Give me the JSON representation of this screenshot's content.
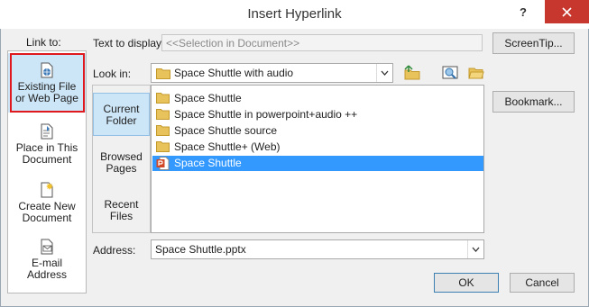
{
  "window": {
    "title": "Insert Hyperlink",
    "help_label": "?",
    "close_icon": "close-icon"
  },
  "link_to": {
    "label": "Link to:",
    "items": [
      {
        "line1": "Existing File",
        "line2": "or Web Page",
        "icon": "globe-document-icon",
        "selected": true
      },
      {
        "line1": "Place in This",
        "line2": "Document",
        "icon": "place-in-document-icon",
        "selected": false
      },
      {
        "line1": "Create New",
        "line2": "Document",
        "icon": "new-document-icon",
        "selected": false
      },
      {
        "line1": "E-mail",
        "line2": "Address",
        "icon": "email-icon",
        "selected": false
      }
    ]
  },
  "text_to_display": {
    "label": "Text to display:",
    "value": "<<Selection in Document>>"
  },
  "buttons": {
    "screentip": "ScreenTip...",
    "bookmark": "Bookmark...",
    "ok": "OK",
    "cancel": "Cancel"
  },
  "look_in": {
    "label": "Look in:",
    "value": "Space Shuttle with audio",
    "tool_icons": [
      "up-one-folder-icon",
      "browse-web-icon",
      "browse-file-icon"
    ]
  },
  "places": [
    {
      "line1": "Current",
      "line2": "Folder",
      "selected": true
    },
    {
      "line1": "Browsed",
      "line2": "Pages",
      "selected": false
    },
    {
      "line1": "Recent",
      "line2": "Files",
      "selected": false
    }
  ],
  "files": [
    {
      "name": "Space Shuttle",
      "type": "folder",
      "selected": false
    },
    {
      "name": "Space Shuttle in powerpoint+audio ++",
      "type": "folder",
      "selected": false
    },
    {
      "name": "Space Shuttle source",
      "type": "folder",
      "selected": false
    },
    {
      "name": "Space Shuttle+ (Web)",
      "type": "folder",
      "selected": false
    },
    {
      "name": "Space Shuttle",
      "type": "powerpoint",
      "selected": true
    }
  ],
  "address": {
    "label": "Address:",
    "value": "Space Shuttle.pptx"
  },
  "colors": {
    "selection_blue": "#3399ff",
    "highlight_light_blue": "#cde6f7",
    "annotation_red": "#e0191f",
    "close_red": "#c7372d",
    "folder_yellow": "#e8c35c"
  }
}
